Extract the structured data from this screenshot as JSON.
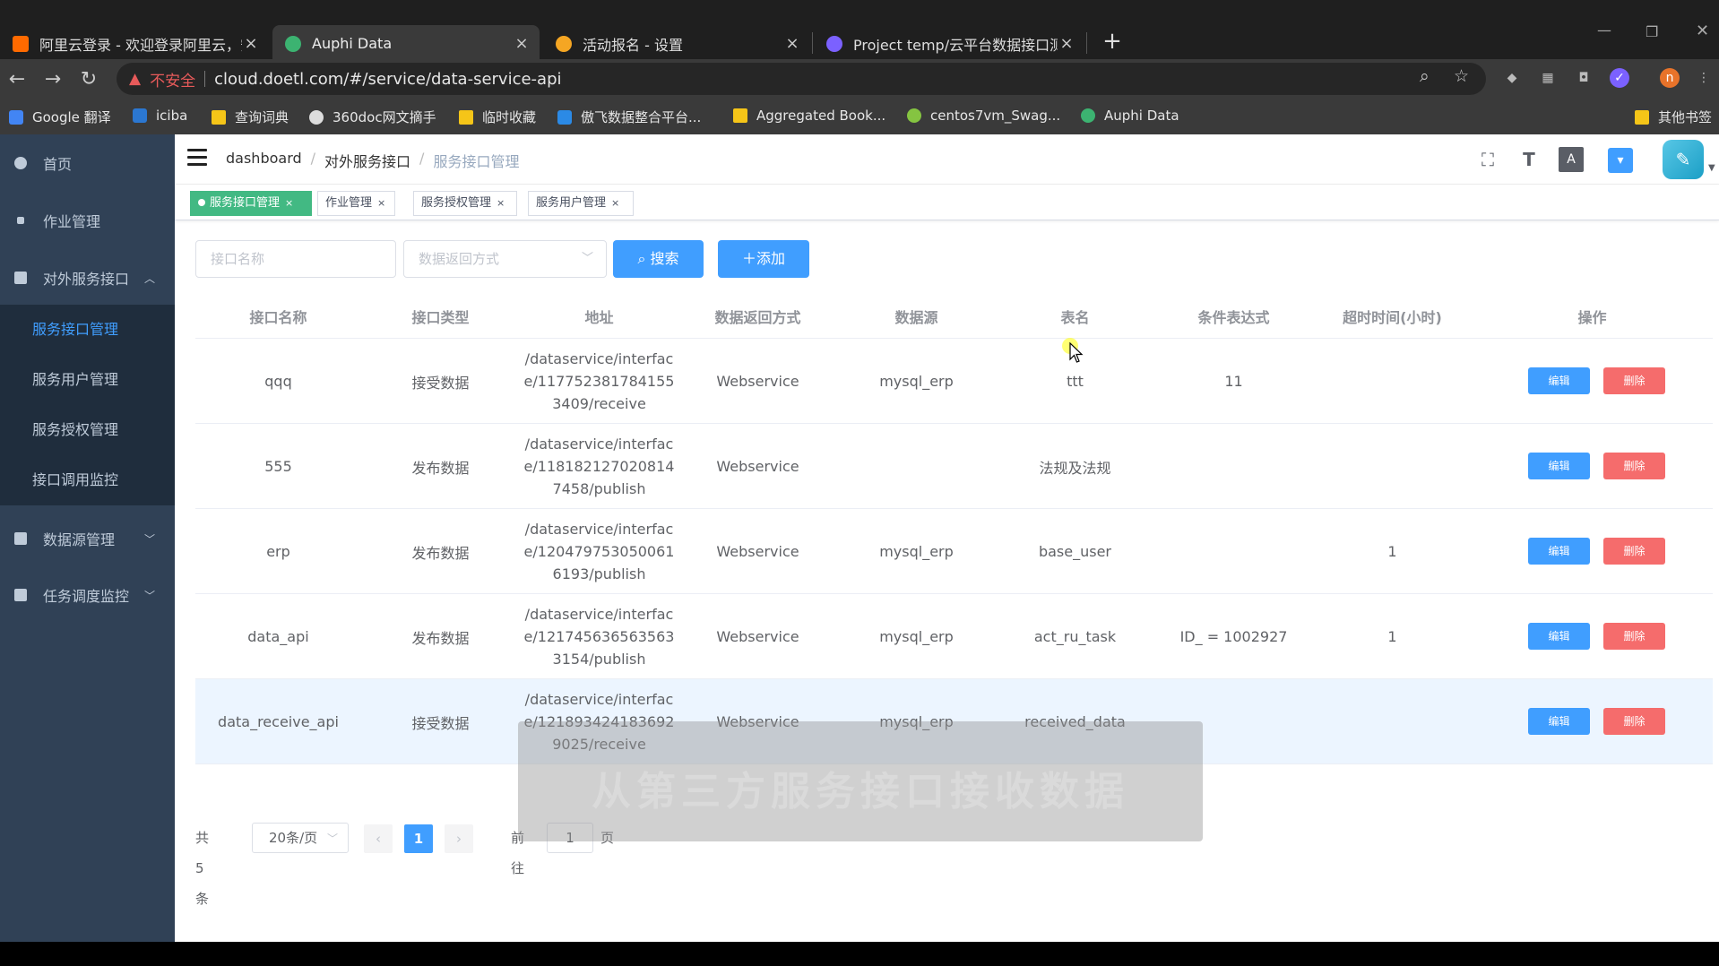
{
  "browser": {
    "tabs": [
      {
        "title": "阿里云登录 - 欢迎登录阿里云，安",
        "favicon_color": "#ff6a00"
      },
      {
        "title": "Auphi Data",
        "favicon_color": "#3cb371"
      },
      {
        "title": "活动报名 - 设置",
        "favicon_color": "#f5a623"
      },
      {
        "title": "Project temp/云平台数据接口测",
        "favicon_color": "#7b61ff"
      }
    ],
    "new_tab": "+",
    "address": {
      "security_label": "不安全",
      "url": "cloud.doetl.com/#/service/data-service-api"
    },
    "bookmarks": [
      {
        "label": "Google 翻译",
        "icon_color": "#4285f4"
      },
      {
        "label": "iciba",
        "icon_color": "#2b77d1"
      },
      {
        "label": "查询词典",
        "icon_color": "#f5c518"
      },
      {
        "label": "360doc网文摘手",
        "icon_color": "#dddddd"
      },
      {
        "label": "临时收藏",
        "icon_color": "#f5c518"
      },
      {
        "label": "傲飞数据整合平台...",
        "icon_color": "#2b8ae6"
      },
      {
        "label": "Aggregated Book...",
        "icon_color": "#f5c518"
      },
      {
        "label": "centos7vm_Swag...",
        "icon_color": "#85c441"
      },
      {
        "label": "Auphi Data",
        "icon_color": "#3cb371"
      },
      {
        "label": "其他书签",
        "icon_color": "#f5c518"
      }
    ],
    "profile_initial": "n"
  },
  "sidebar": {
    "items": [
      {
        "label": "首页",
        "icon": "dashboard-icon"
      },
      {
        "label": "作业管理",
        "icon": "job-icon"
      },
      {
        "label": "对外服务接口",
        "icon": "table-icon",
        "expanded": true,
        "children": [
          "服务接口管理",
          "服务用户管理",
          "服务授权管理",
          "接口调用监控"
        ]
      },
      {
        "label": "数据源管理",
        "icon": "table-icon",
        "expanded": false
      },
      {
        "label": "任务调度监控",
        "icon": "table-icon",
        "expanded": false
      }
    ],
    "active_child": "服务接口管理"
  },
  "header": {
    "breadcrumb": [
      "dashboard",
      "对外服务接口",
      "服务接口管理"
    ]
  },
  "tags_view": [
    {
      "label": "服务接口管理",
      "active": true
    },
    {
      "label": "作业管理",
      "active": false
    },
    {
      "label": "服务授权管理",
      "active": false
    },
    {
      "label": "服务用户管理",
      "active": false
    }
  ],
  "filters": {
    "name_placeholder": "接口名称",
    "return_mode_placeholder": "数据返回方式",
    "search_label": "搜索",
    "add_label": "添加"
  },
  "table": {
    "columns": [
      "接口名称",
      "接口类型",
      "地址",
      "数据返回方式",
      "数据源",
      "表名",
      "条件表达式",
      "超时时间(小时)",
      "操作"
    ],
    "rows": [
      {
        "name": "qqq",
        "type": "接受数据",
        "address": "/dataservice/interface/1177523817841553409/receive",
        "return_mode": "Webservice",
        "datasource": "mysql_erp",
        "table": "ttt",
        "condition": "11",
        "timeout": ""
      },
      {
        "name": "555",
        "type": "发布数据",
        "address": "/dataservice/interface/1181821270208147458/publish",
        "return_mode": "Webservice",
        "datasource": "",
        "table": "法规及法规",
        "condition": "",
        "timeout": ""
      },
      {
        "name": "erp",
        "type": "发布数据",
        "address": "/dataservice/interface/1204797530500616193/publish",
        "return_mode": "Webservice",
        "datasource": "mysql_erp",
        "table": "base_user",
        "condition": "",
        "timeout": "1"
      },
      {
        "name": "data_api",
        "type": "发布数据",
        "address": "/dataservice/interface/1217456365635633154/publish",
        "return_mode": "Webservice",
        "datasource": "mysql_erp",
        "table": "act_ru_task",
        "condition": "ID_ = 1002927",
        "timeout": "1"
      },
      {
        "name": "data_receive_api",
        "type": "接受数据",
        "address": "/dataservice/interface/1218934241836929025/receive",
        "return_mode": "Webservice",
        "datasource": "mysql_erp",
        "table": "received_data",
        "condition": "",
        "timeout": ""
      }
    ],
    "edit_label": "编辑",
    "delete_label": "删除"
  },
  "pagination": {
    "total_label": "共 5 条",
    "page_size": "20条/页",
    "current_page": "1",
    "goto_prefix": "前往",
    "goto_value": "1",
    "goto_suffix": "页"
  },
  "overlay_caption": "从第三方服务接口接收数据",
  "colors": {
    "primary": "#409eff",
    "danger": "#f56c6c",
    "sidebar_bg": "#304156",
    "tag_active": "#42b983"
  }
}
